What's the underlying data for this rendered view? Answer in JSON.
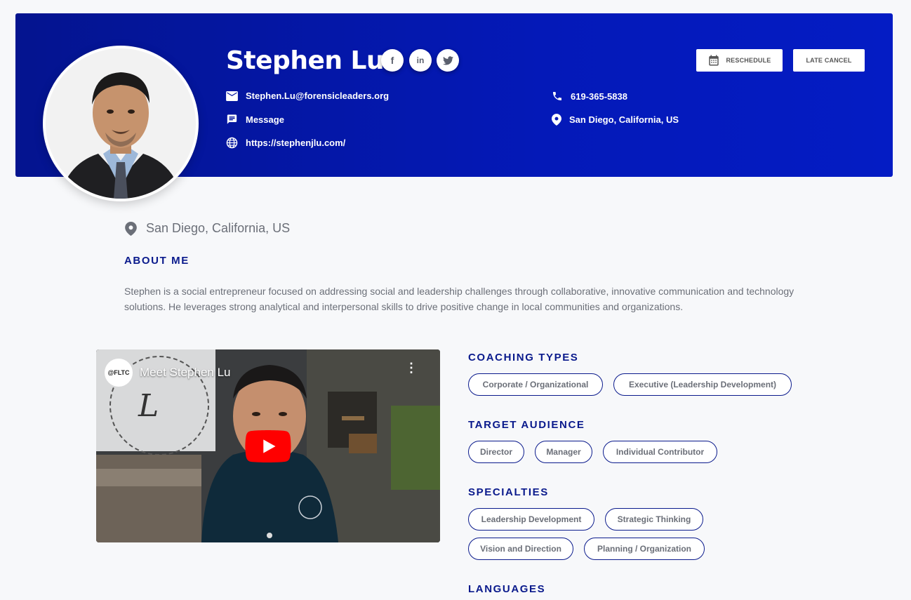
{
  "profile": {
    "name": "Stephen Lu",
    "email": "Stephen.Lu@forensicleaders.org",
    "message_label": "Message",
    "website": "https://stephenjlu.com/",
    "phone": "619-365-5838",
    "location": "San Diego, California, US"
  },
  "social": {
    "facebook": "f",
    "linkedin": "in",
    "twitter": "🐦"
  },
  "buttons": {
    "reschedule": "RESCHEDULE",
    "late_cancel": "LATE CANCEL"
  },
  "location_line": "San Diego, California, US",
  "about": {
    "heading": "ABOUT ME",
    "text": "Stephen is a social entrepreneur focused on addressing social and leadership challenges through collaborative, innovative communication and technology solutions. He leverages strong analytical and interpersonal skills to drive positive change in local communities and organizations."
  },
  "video": {
    "channel_logo": "@FLTC",
    "title": "Meet Stephen Lu",
    "menu": "⋮"
  },
  "coaching_types": {
    "heading": "COACHING TYPES",
    "items": [
      "Corporate / Organizational",
      "Executive (Leadership Development)"
    ]
  },
  "target_audience": {
    "heading": "TARGET AUDIENCE",
    "items": [
      "Director",
      "Manager",
      "Individual Contributor"
    ]
  },
  "specialties": {
    "heading": "SPECIALTIES",
    "items": [
      "Leadership Development",
      "Strategic Thinking",
      "Vision and Direction",
      "Planning / Organization"
    ]
  },
  "languages": {
    "heading": "LANGUAGES"
  },
  "colors": {
    "hero": "#0419b8",
    "accent": "#0a1a8c",
    "youtube_red": "#ff0000"
  }
}
